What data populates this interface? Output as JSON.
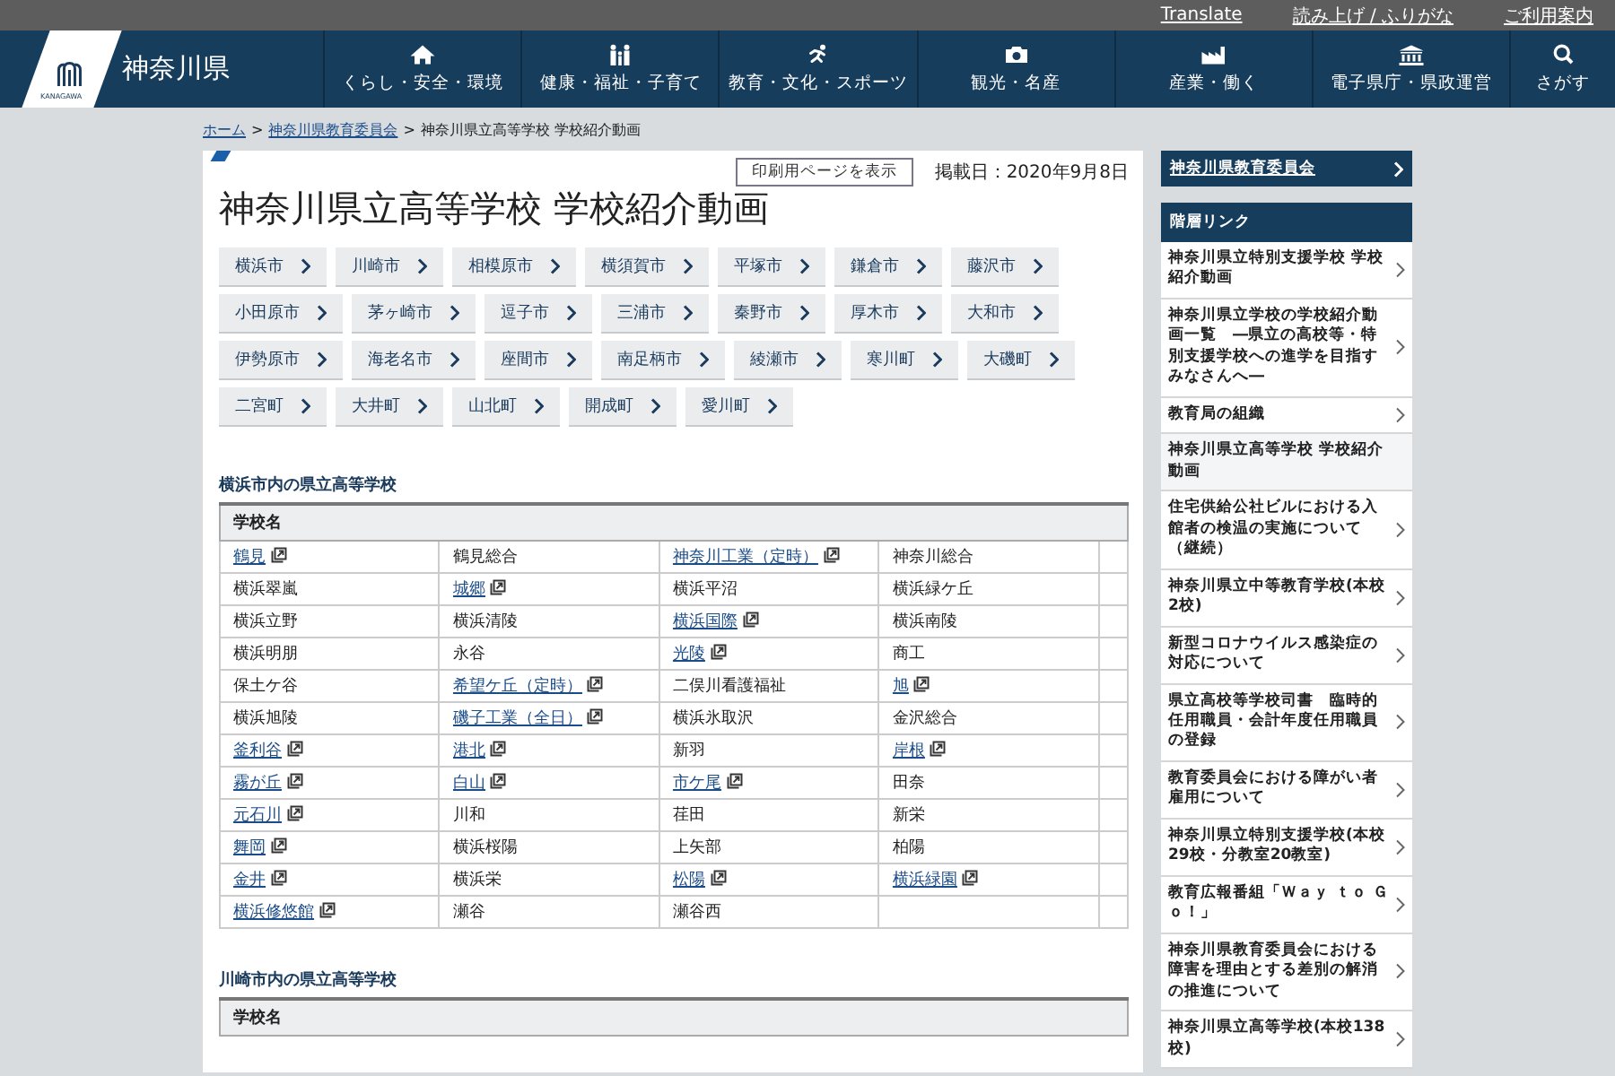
{
  "utility_links": [
    "Translate",
    "読み上げ / ふりがな",
    "ご利用案内"
  ],
  "logo": {
    "text": "神奈川県",
    "subtext": "KANAGAWA"
  },
  "nav": [
    "くらし・安全・環境",
    "健康・福祉・子育て",
    "教育・文化・スポーツ",
    "観光・名産",
    "産業・働く",
    "電子県庁・県政運営",
    "さがす"
  ],
  "breadcrumb": [
    {
      "label": "ホーム",
      "link": true
    },
    {
      "label": "神奈川県教育委員会",
      "link": true
    },
    {
      "label": "神奈川県立高等学校 学校紹介動画",
      "link": false
    }
  ],
  "separator": ">",
  "print_button": "印刷用ページを表示",
  "posted_date": "掲載日：2020年9月8日",
  "title": "神奈川県立高等学校 学校紹介動画",
  "city_buttons": [
    [
      "横浜市",
      "川崎市",
      "相模原市",
      "横須賀市",
      "平塚市",
      "鎌倉市",
      "藤沢市"
    ],
    [
      "小田原市",
      "茅ヶ崎市",
      "逗子市",
      "三浦市",
      "秦野市",
      "厚木市",
      "大和市"
    ],
    [
      "伊勢原市",
      "海老名市",
      "座間市",
      "南足柄市",
      "綾瀬市",
      "寒川町",
      "大磯町"
    ],
    [
      "二宮町",
      "大井町",
      "山北町",
      "開成町",
      "愛川町"
    ]
  ],
  "sections": [
    {
      "heading": "横浜市内の県立高等学校",
      "column_header": "学校名",
      "rows": [
        [
          {
            "text": "鶴見",
            "link": true
          },
          {
            "text": "鶴見総合",
            "link": false
          },
          {
            "text": "神奈川工業（定時）",
            "link": true
          },
          {
            "text": "神奈川総合",
            "link": false
          }
        ],
        [
          {
            "text": "横浜翠嵐",
            "link": false
          },
          {
            "text": "城郷",
            "link": true
          },
          {
            "text": "横浜平沼",
            "link": false
          },
          {
            "text": "横浜緑ケ丘",
            "link": false
          }
        ],
        [
          {
            "text": "横浜立野",
            "link": false
          },
          {
            "text": "横浜清陵",
            "link": false
          },
          {
            "text": "横浜国際",
            "link": true
          },
          {
            "text": "横浜南陵",
            "link": false
          }
        ],
        [
          {
            "text": "横浜明朋",
            "link": false
          },
          {
            "text": "永谷",
            "link": false
          },
          {
            "text": "光陵",
            "link": true
          },
          {
            "text": "商工",
            "link": false
          }
        ],
        [
          {
            "text": "保土ケ谷",
            "link": false
          },
          {
            "text": "希望ケ丘（定時）",
            "link": true
          },
          {
            "text": "二俣川看護福祉",
            "link": false
          },
          {
            "text": "旭",
            "link": true
          }
        ],
        [
          {
            "text": "横浜旭陵",
            "link": false
          },
          {
            "text": "磯子工業（全日）",
            "link": true
          },
          {
            "text": "横浜氷取沢",
            "link": false
          },
          {
            "text": "金沢総合",
            "link": false
          }
        ],
        [
          {
            "text": "釜利谷",
            "link": true
          },
          {
            "text": "港北",
            "link": true
          },
          {
            "text": "新羽",
            "link": false
          },
          {
            "text": "岸根",
            "link": true
          }
        ],
        [
          {
            "text": "霧が丘",
            "link": true
          },
          {
            "text": "白山",
            "link": true
          },
          {
            "text": "市ケ尾",
            "link": true
          },
          {
            "text": "田奈",
            "link": false
          }
        ],
        [
          {
            "text": "元石川",
            "link": true
          },
          {
            "text": "川和",
            "link": false
          },
          {
            "text": "荏田",
            "link": false
          },
          {
            "text": "新栄",
            "link": false
          }
        ],
        [
          {
            "text": "舞岡",
            "link": true
          },
          {
            "text": "横浜桜陽",
            "link": false
          },
          {
            "text": "上矢部",
            "link": false
          },
          {
            "text": "柏陽",
            "link": false
          }
        ],
        [
          {
            "text": "金井",
            "link": true
          },
          {
            "text": "横浜栄",
            "link": false
          },
          {
            "text": "松陽",
            "link": true
          },
          {
            "text": "横浜緑園",
            "link": true
          }
        ],
        [
          {
            "text": "横浜修悠館",
            "link": true
          },
          {
            "text": "瀬谷",
            "link": false
          },
          {
            "text": "瀬谷西",
            "link": false
          }
        ]
      ]
    },
    {
      "heading": "川崎市内の県立高等学校",
      "column_header": "学校名"
    }
  ],
  "sidebar": {
    "top_link": "神奈川県教育委員会",
    "section_title": "階層リンク",
    "items": [
      {
        "label": "神奈川県立特別支援学校 学校紹介動画",
        "selected": false
      },
      {
        "label": "神奈川県立学校の学校紹介動画一覧　―県立の高校等・特別支援学校への進学を目指すみなさんへ―",
        "selected": false
      },
      {
        "label": "教育局の組織",
        "selected": false
      },
      {
        "label": "神奈川県立高等学校 学校紹介動画",
        "selected": true
      },
      {
        "label": "住宅供給公社ビルにおける入館者の検温の実施について（継続）",
        "selected": false
      },
      {
        "label": "神奈川県立中等教育学校(本校2校)",
        "selected": false
      },
      {
        "label": "新型コロナウイルス感染症の対応について",
        "selected": false
      },
      {
        "label": "県立高校等学校司書　臨時的任用職員・会計年度任用職員の登録",
        "selected": false
      },
      {
        "label": "教育委員会における障がい者雇用について",
        "selected": false
      },
      {
        "label": "神奈川県立特別支援学校(本校29校・分教室20教室)",
        "selected": false
      },
      {
        "label": "教育広報番組「Ｗａｙ ｔｏ Ｇｏ！」",
        "selected": false
      },
      {
        "label": "神奈川県教育委員会における障害を理由とする差別の解消の推進について",
        "selected": false
      },
      {
        "label": "神奈川県立高等学校(本校138校)",
        "selected": false
      }
    ]
  }
}
